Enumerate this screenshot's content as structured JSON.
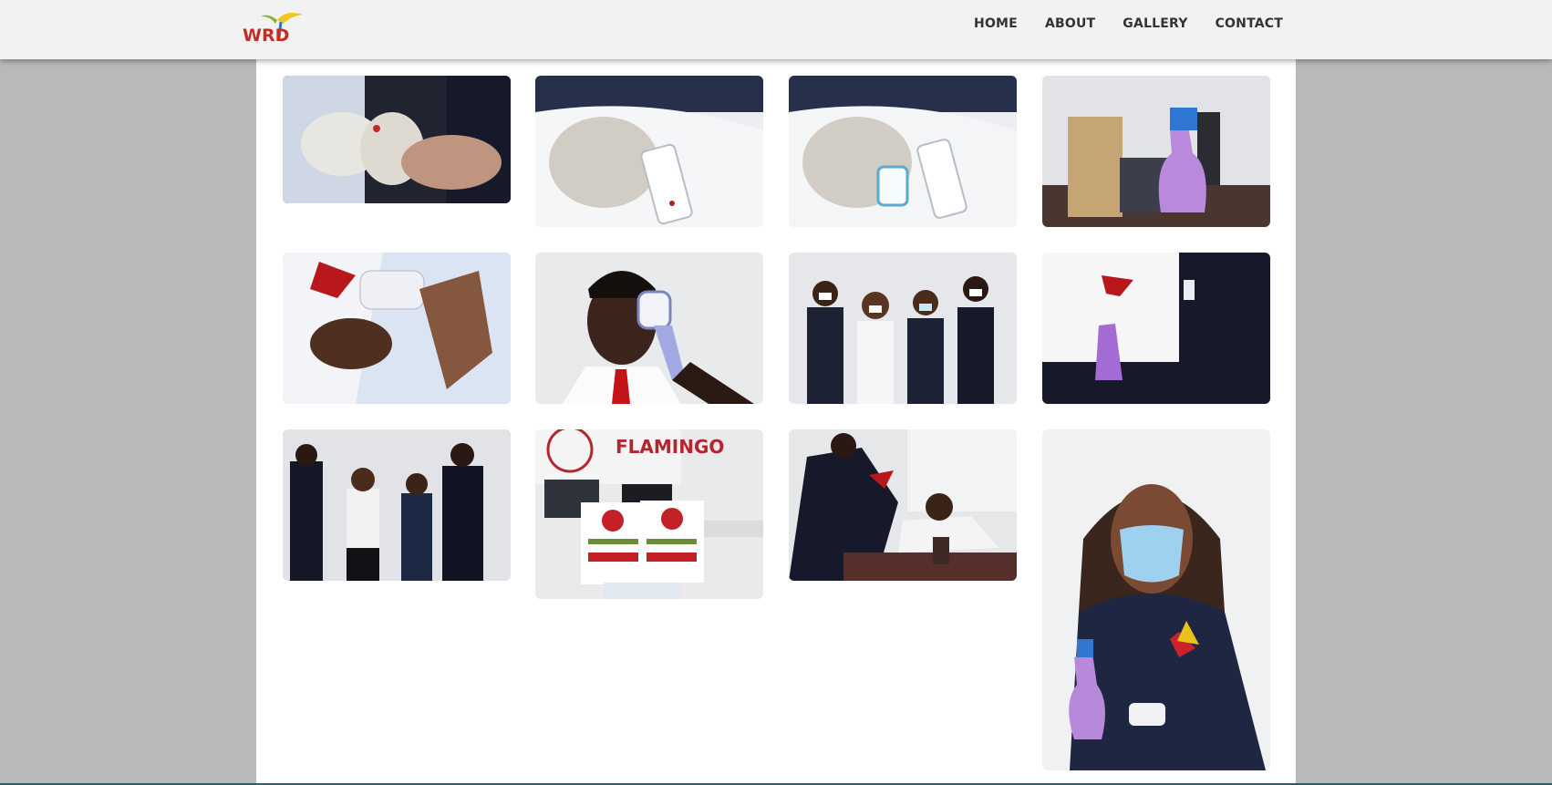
{
  "brand": {
    "logo_text": "WRD",
    "logo_icon": "wrd-logo-icon"
  },
  "nav": {
    "items": [
      {
        "label": "HOME"
      },
      {
        "label": "ABOUT"
      },
      {
        "label": "GALLERY"
      },
      {
        "label": "CONTACT"
      }
    ]
  },
  "colors": {
    "header_bg": "#f2f2f2",
    "page_bg": "#b9b9b9",
    "content_bg": "#ffffff",
    "nav_text": "#333333"
  },
  "gallery": {
    "photos": [
      {
        "subject": "gloved-hands-finger-prick-photo"
      },
      {
        "subject": "test-cassette-blood-drop-photo"
      },
      {
        "subject": "test-cassette-buffer-bottle-photo"
      },
      {
        "subject": "sanitizer-spray-bottle-office-photo"
      },
      {
        "subject": "infrared-thermometer-hand-photo"
      },
      {
        "subject": "forehead-temperature-check-photo"
      },
      {
        "subject": "team-four-masked-staff-photo"
      },
      {
        "subject": "staff-holding-spray-bottle-photo"
      },
      {
        "subject": "team-sanitizing-hands-photo"
      },
      {
        "subject": "man-holding-covid-posters-photo",
        "poster_text": "FLAMINGO"
      },
      {
        "subject": "staff-at-office-desk-photo"
      },
      {
        "subject": "woman-mask-spray-thermometer-photo"
      }
    ]
  }
}
